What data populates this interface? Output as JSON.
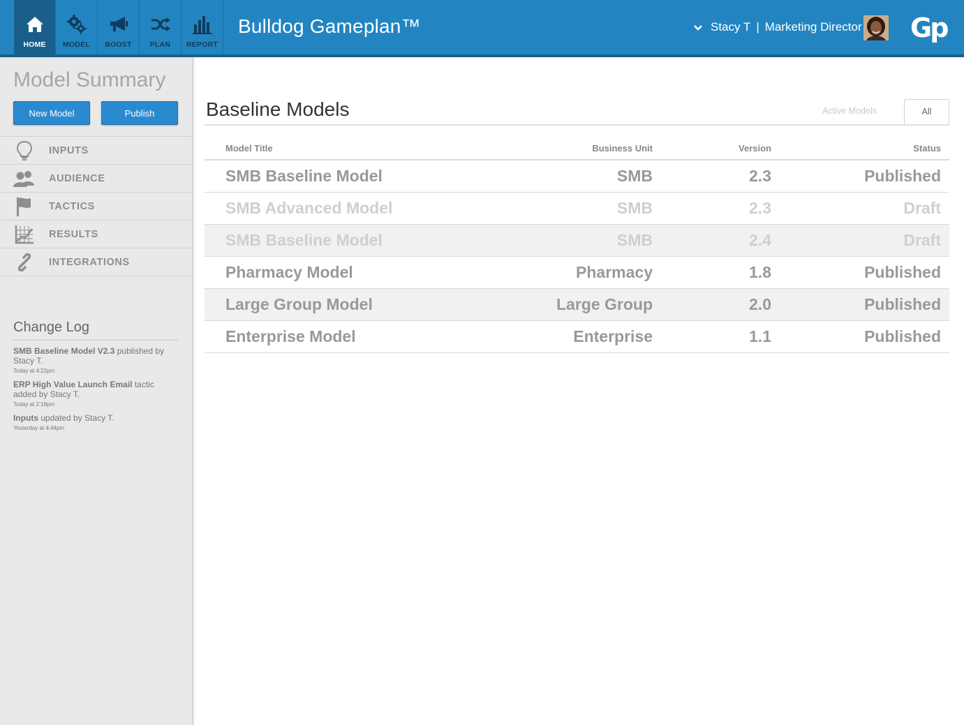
{
  "header": {
    "app_title": "Bulldog Gameplan™",
    "user_name": "Stacy T",
    "separator": "|",
    "user_role": "Marketing Director",
    "logo_text": "Gp",
    "nav": [
      {
        "label": "HOME",
        "icon": "home-icon"
      },
      {
        "label": "MODEL",
        "icon": "gears-icon"
      },
      {
        "label": "BOOST",
        "icon": "megaphone-icon"
      },
      {
        "label": "PLAN",
        "icon": "shuffle-icon"
      },
      {
        "label": "REPORT",
        "icon": "bar-chart-icon"
      }
    ]
  },
  "sidebar": {
    "title": "Model Summary",
    "new_model_label": "New Model",
    "publish_label": "Publish",
    "menu": [
      {
        "label": "INPUTS",
        "icon": "lightbulb-icon"
      },
      {
        "label": "AUDIENCE",
        "icon": "users-icon"
      },
      {
        "label": "TACTICS",
        "icon": "flag-icon"
      },
      {
        "label": "RESULTS",
        "icon": "line-chart-icon"
      },
      {
        "label": "INTEGRATIONS",
        "icon": "link-icon"
      }
    ],
    "changelog": {
      "title": "Change Log",
      "entries": [
        {
          "bold": "SMB Baseline Model V2.3",
          "text": " published by Stacy T.",
          "time": "Today at 4:22pm"
        },
        {
          "bold": "ERP High Value Launch Email",
          "text": " tactic added by Stacy T.",
          "time": "Today at 2:18pm"
        },
        {
          "bold": "Inputs",
          "text": " updated by Stacy T.",
          "time": "Yesterday at 4:44pm"
        }
      ]
    }
  },
  "main": {
    "title": "Baseline Models",
    "tabs": {
      "active_models": "Active Models",
      "all": "All"
    },
    "columns": {
      "title": "Model Title",
      "business_unit": "Business Unit",
      "version": "Version",
      "status": "Status"
    },
    "rows": [
      {
        "title": "SMB Baseline Model",
        "business_unit": "SMB",
        "version": "2.3",
        "status": "Published"
      },
      {
        "title": "SMB Advanced Model",
        "business_unit": "SMB",
        "version": "2.3",
        "status": "Draft"
      },
      {
        "title": "SMB Baseline Model",
        "business_unit": "SMB",
        "version": "2.4",
        "status": "Draft"
      },
      {
        "title": "Pharmacy Model",
        "business_unit": "Pharmacy",
        "version": "1.8",
        "status": "Published"
      },
      {
        "title": "Large Group Model",
        "business_unit": "Large Group",
        "version": "2.0",
        "status": "Published"
      },
      {
        "title": "Enterprise Model",
        "business_unit": "Enterprise",
        "version": "1.1",
        "status": "Published"
      }
    ]
  },
  "colors": {
    "header_bg": "#2285c1",
    "accent_button": "#2a8ad0",
    "sidebar_bg": "#e9e9e9"
  }
}
